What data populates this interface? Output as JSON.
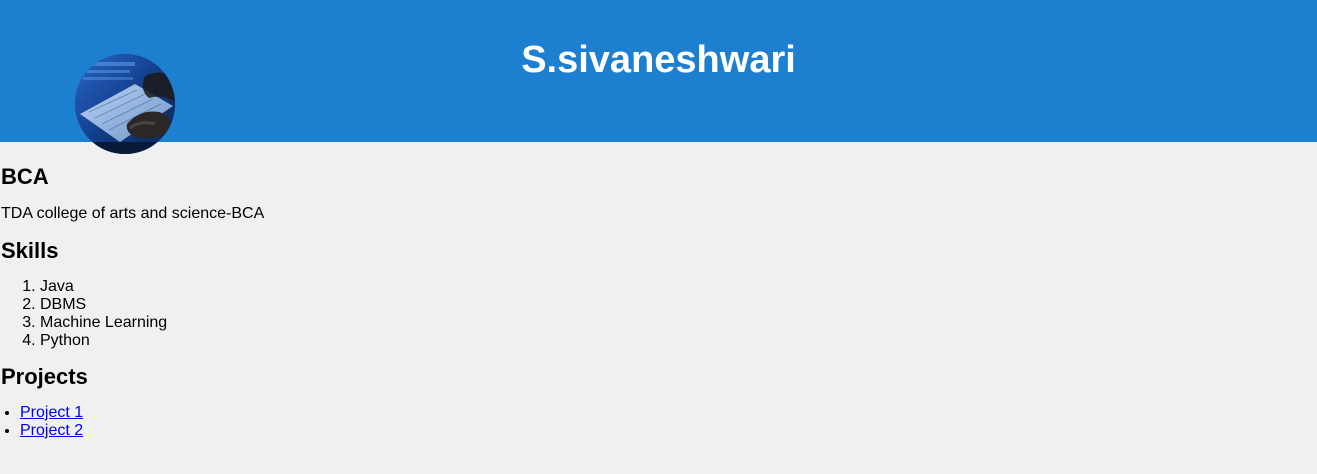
{
  "header": {
    "name": "S.sivaneshwari",
    "background_color": "#1c7fd0",
    "avatar_icon": "laptop-typing-photo"
  },
  "education": {
    "heading": "BCA",
    "college": "TDA college of arts and science-BCA"
  },
  "skills": {
    "heading": "Skills",
    "items": [
      "Java",
      "DBMS",
      "Machine Learning",
      "Python"
    ]
  },
  "projects": {
    "heading": "Projects",
    "items": [
      "Project 1",
      "Project 2"
    ],
    "link_color": "#0000ee"
  },
  "page_background": "#f0f0f0"
}
